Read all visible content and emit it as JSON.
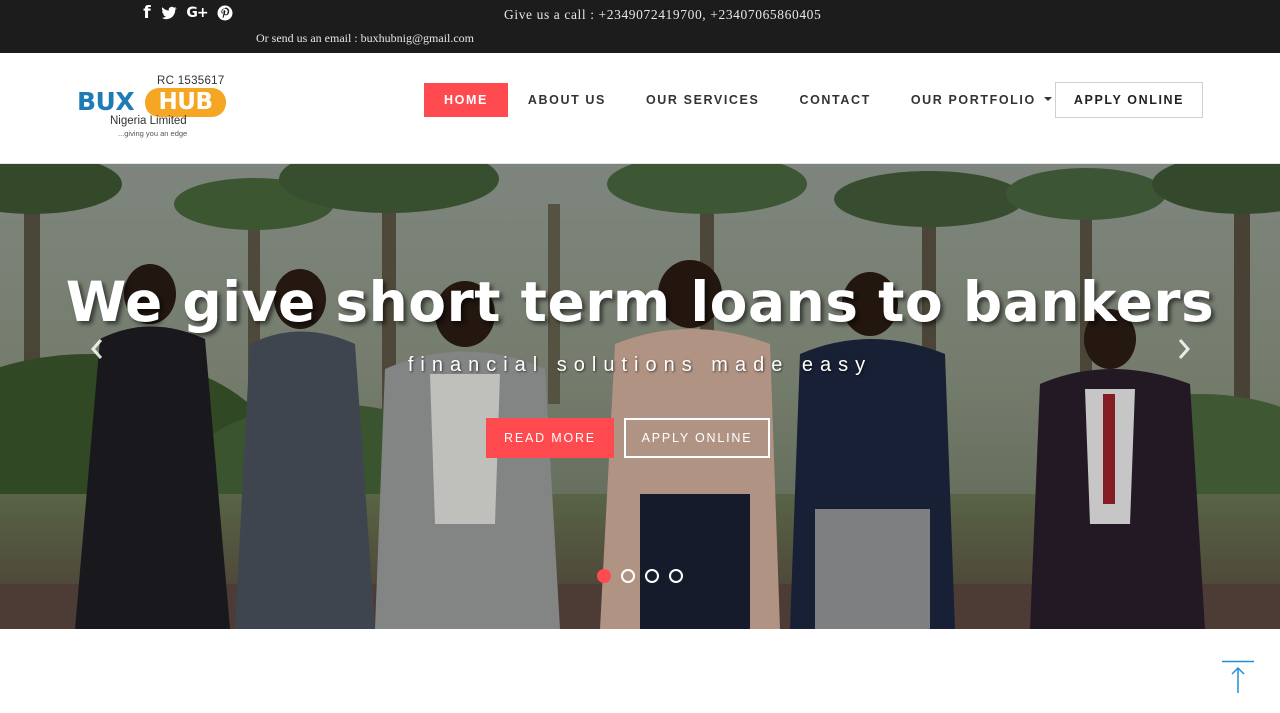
{
  "topbar": {
    "social": [
      {
        "icon": "facebook-icon",
        "glyph": "f"
      },
      {
        "icon": "twitter-icon",
        "glyph": ""
      },
      {
        "icon": "google-plus-icon",
        "glyph": "G+"
      },
      {
        "icon": "pinterest-icon",
        "glyph": ""
      }
    ],
    "call_text": "Give us a call : +2349072419700, +23407065860405",
    "email_text": "Or send us an email : buxhubnig@gmail.com"
  },
  "logo": {
    "rc": "RC 1535617",
    "bux": "BUX",
    "hub": "HUB",
    "company": "Nigeria Limited",
    "tagline": "...giving you an edge"
  },
  "nav": {
    "items": [
      {
        "label": "HOME",
        "active": true
      },
      {
        "label": "ABOUT US"
      },
      {
        "label": "OUR SERVICES"
      },
      {
        "label": "CONTACT"
      },
      {
        "label": "OUR PORTFOLIO",
        "dropdown": true
      }
    ],
    "apply_label": "APPLY ONLINE"
  },
  "hero": {
    "title": "We give short term loans to bankers",
    "subtitle": "financial solutions made easy",
    "read_more": "READ MORE",
    "apply_online": "APPLY ONLINE",
    "slides": 4,
    "active_slide": 1
  },
  "colors": {
    "accent": "#ff4a4f",
    "topbar_bg": "#1c1c1c",
    "brand_blue": "#1f7bb5",
    "brand_orange": "#f5a623",
    "totop_blue": "#1e90d6"
  }
}
